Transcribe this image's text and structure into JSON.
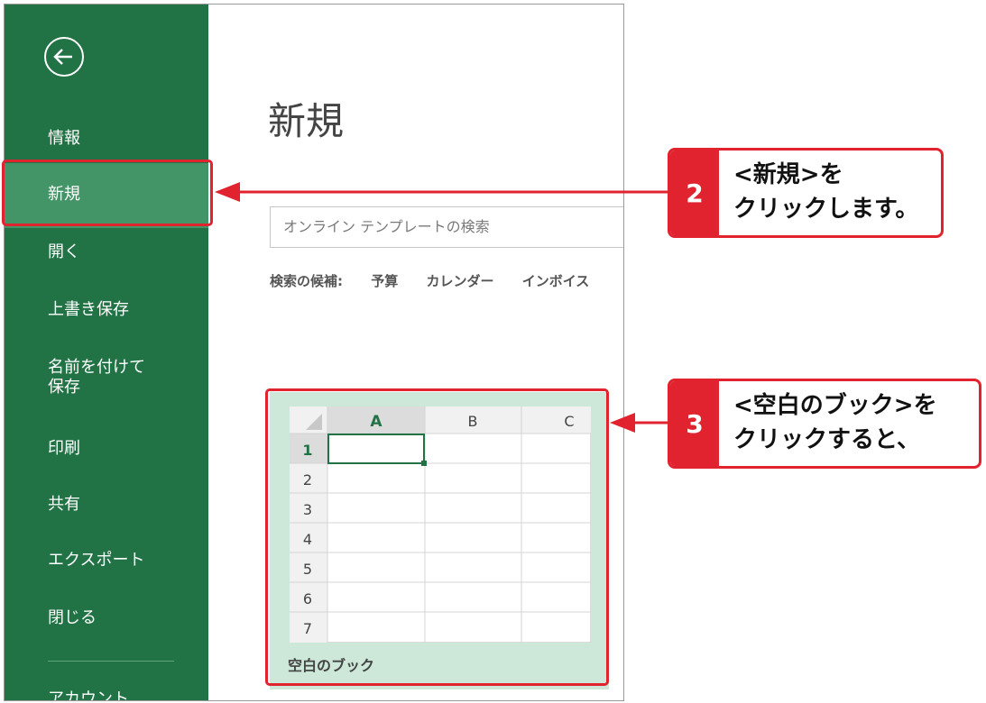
{
  "sidebar": {
    "items": [
      {
        "label": "情報"
      },
      {
        "label": "新規"
      },
      {
        "label": "開く"
      },
      {
        "label": "上書き保存"
      },
      {
        "label": "名前を付けて\n保存"
      },
      {
        "label": "印刷"
      },
      {
        "label": "共有"
      },
      {
        "label": "エクスポート"
      },
      {
        "label": "閉じる"
      },
      {
        "label": "アカウント"
      }
    ]
  },
  "main": {
    "title": "新規",
    "search": {
      "placeholder": "オンライン テンプレートの検索"
    },
    "suggestions": {
      "label": "検索の候補:",
      "items": [
        "予算",
        "カレンダー",
        "インボイス"
      ]
    },
    "template": {
      "label": "空白のブック",
      "columns": [
        "A",
        "B",
        "C"
      ],
      "rows": [
        "1",
        "2",
        "3",
        "4",
        "5",
        "6",
        "7"
      ]
    }
  },
  "callouts": [
    {
      "number": "2",
      "text": "<新規>を\nクリックします。"
    },
    {
      "number": "3",
      "text": "<空白のブック>を\nクリックすると、"
    }
  ],
  "colors": {
    "sidebar": "#217346",
    "sidebar_selected": "#439467",
    "highlight": "#e1232f",
    "template_bg": "#cde7d8"
  }
}
